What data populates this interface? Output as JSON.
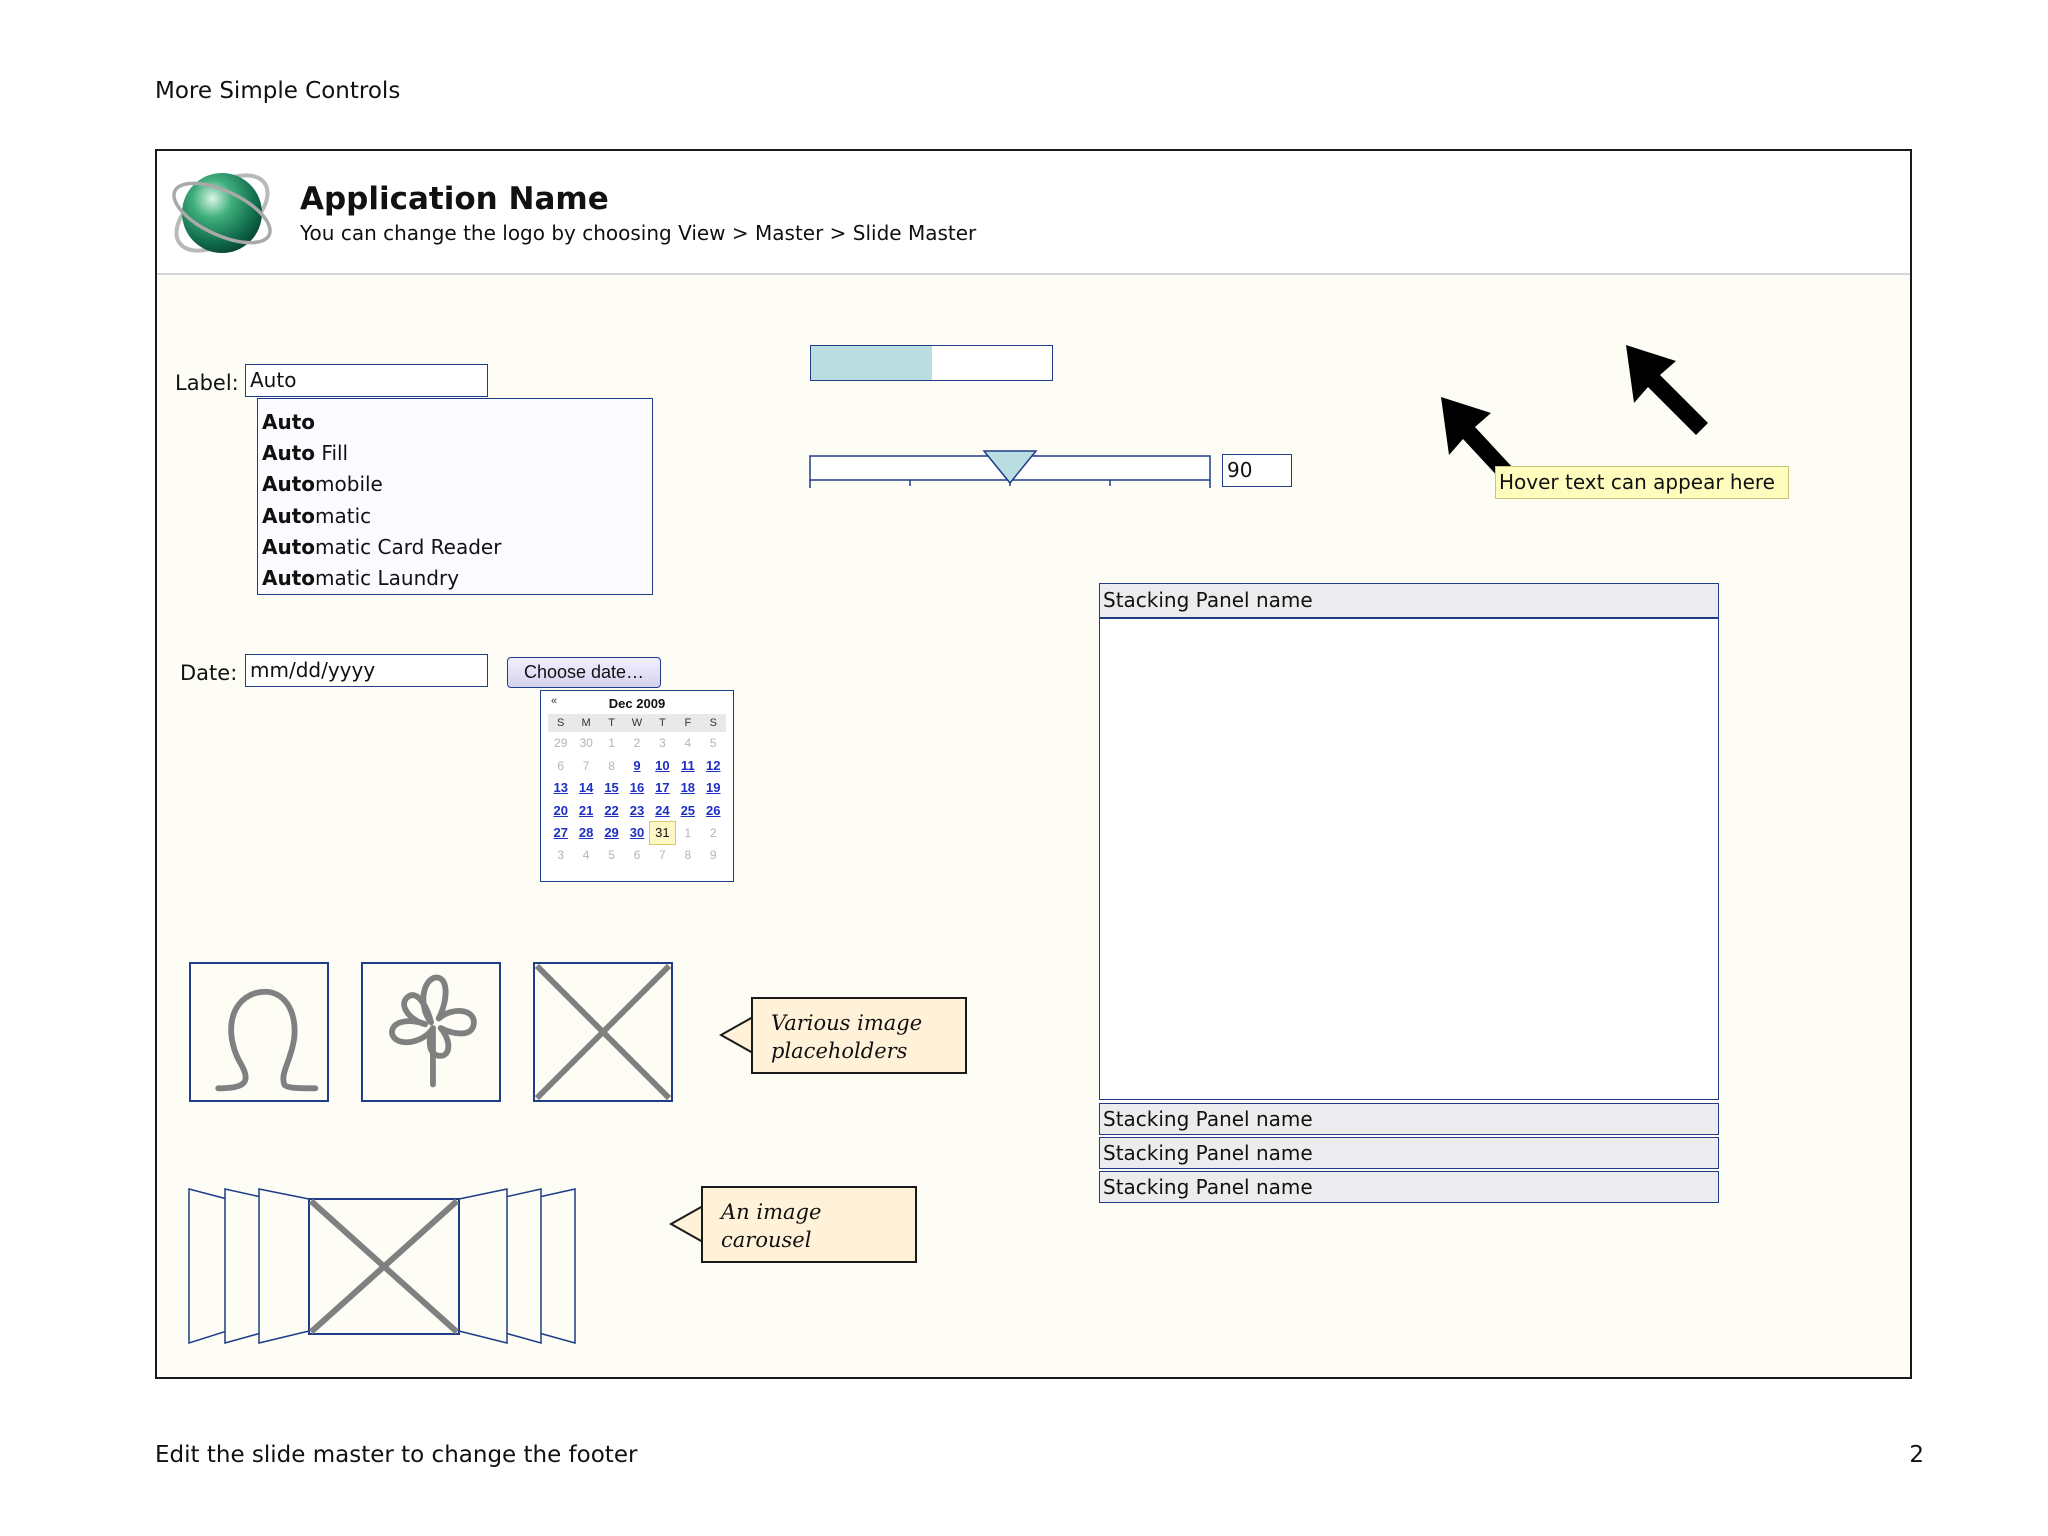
{
  "page": {
    "heading": "More Simple Controls",
    "footer": "Edit the slide master to change the footer",
    "page_number": "2"
  },
  "app": {
    "name": "Application Name",
    "subtitle": "You can change the logo by choosing View > Master > Slide Master",
    "logo_icon": "globe-logo-icon"
  },
  "autocomplete": {
    "label": "Label:",
    "value": "Auto",
    "suggestions": [
      {
        "match": "Auto",
        "rest": ""
      },
      {
        "match": "Auto",
        "rest": " Fill"
      },
      {
        "match": "Auto",
        "rest": "mobile"
      },
      {
        "match": "Auto",
        "rest": "matic"
      },
      {
        "match": "Auto",
        "rest": "matic Card Reader"
      },
      {
        "match": "Auto",
        "rest": "matic Laundry"
      }
    ]
  },
  "date_picker": {
    "label": "Date:",
    "placeholder": "mm/dd/yyyy",
    "button_label": "Choose date…",
    "calendar": {
      "prev_label": "«",
      "month_title": "Dec 2009",
      "weekdays": [
        "S",
        "M",
        "T",
        "W",
        "T",
        "F",
        "S"
      ],
      "weeks": [
        [
          {
            "d": "29",
            "s": "off"
          },
          {
            "d": "30",
            "s": "off"
          },
          {
            "d": "1",
            "s": "off"
          },
          {
            "d": "2",
            "s": "off"
          },
          {
            "d": "3",
            "s": "off"
          },
          {
            "d": "4",
            "s": "off"
          },
          {
            "d": "5",
            "s": "off"
          }
        ],
        [
          {
            "d": "6",
            "s": "off"
          },
          {
            "d": "7",
            "s": "off"
          },
          {
            "d": "8",
            "s": "off"
          },
          {
            "d": "9",
            "s": "on"
          },
          {
            "d": "10",
            "s": "on"
          },
          {
            "d": "11",
            "s": "on"
          },
          {
            "d": "12",
            "s": "on"
          }
        ],
        [
          {
            "d": "13",
            "s": "on"
          },
          {
            "d": "14",
            "s": "on"
          },
          {
            "d": "15",
            "s": "on"
          },
          {
            "d": "16",
            "s": "on"
          },
          {
            "d": "17",
            "s": "on"
          },
          {
            "d": "18",
            "s": "on"
          },
          {
            "d": "19",
            "s": "on"
          }
        ],
        [
          {
            "d": "20",
            "s": "on"
          },
          {
            "d": "21",
            "s": "on"
          },
          {
            "d": "22",
            "s": "on"
          },
          {
            "d": "23",
            "s": "on"
          },
          {
            "d": "24",
            "s": "on"
          },
          {
            "d": "25",
            "s": "on"
          },
          {
            "d": "26",
            "s": "on"
          }
        ],
        [
          {
            "d": "27",
            "s": "on"
          },
          {
            "d": "28",
            "s": "on"
          },
          {
            "d": "29",
            "s": "on"
          },
          {
            "d": "30",
            "s": "on"
          },
          {
            "d": "31",
            "s": "today"
          },
          {
            "d": "1",
            "s": "off"
          },
          {
            "d": "2",
            "s": "off"
          }
        ],
        [
          {
            "d": "3",
            "s": "off"
          },
          {
            "d": "4",
            "s": "off"
          },
          {
            "d": "5",
            "s": "off"
          },
          {
            "d": "6",
            "s": "off"
          },
          {
            "d": "7",
            "s": "off"
          },
          {
            "d": "8",
            "s": "off"
          },
          {
            "d": "9",
            "s": "off"
          }
        ]
      ]
    }
  },
  "progress": {
    "fraction": 0.5
  },
  "slider": {
    "value": "90",
    "position_fraction": 0.5
  },
  "tooltip": {
    "text": "Hover text can appear here"
  },
  "stacking_panels": {
    "headers": [
      "Stacking Panel name",
      "Stacking Panel name",
      "Stacking Panel name",
      "Stacking Panel name"
    ]
  },
  "image_placeholders": {
    "callout": [
      "Various image",
      "placeholders"
    ]
  },
  "carousel": {
    "callout": [
      "An image",
      "carousel"
    ]
  }
}
